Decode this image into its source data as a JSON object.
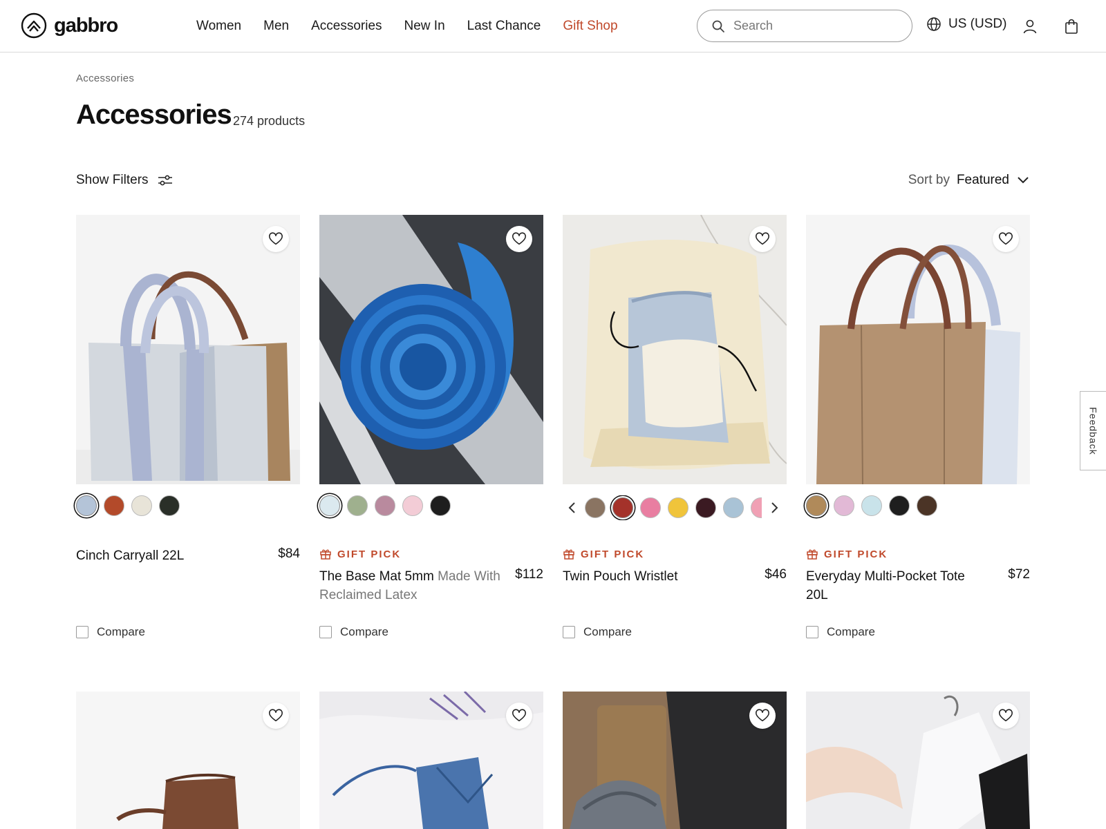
{
  "header": {
    "brand": "gabbro",
    "nav": [
      {
        "label": "Women"
      },
      {
        "label": "Men"
      },
      {
        "label": "Accessories"
      },
      {
        "label": "New In"
      },
      {
        "label": "Last Chance"
      },
      {
        "label": "Gift Shop",
        "color": "#c0492b"
      }
    ],
    "search_placeholder": "Search",
    "locale": "US (USD)"
  },
  "breadcrumb": "Accessories",
  "page": {
    "title": "Accessories",
    "count": "274 products"
  },
  "toolbar": {
    "filters_label": "Show Filters",
    "sort_label": "Sort by",
    "sort_value": "Featured"
  },
  "products": [
    {
      "name": "Cinch Carryall 22L",
      "subtitle": "",
      "price": "$84",
      "gift_pick": false,
      "compare_label": "Compare",
      "swatches": [
        "#b4c4d8",
        "#b34a2a",
        "#e8e4d8",
        "#2a2f28"
      ],
      "selected_swatch": 0
    },
    {
      "name": "The Base Mat 5mm",
      "subtitle": "Made With Reclaimed Latex",
      "price": "$112",
      "gift_pick": true,
      "gift_label": "GIFT PICK",
      "compare_label": "Compare",
      "swatches": [
        "#dbe9ef",
        "#9fb08e",
        "#b98a9e",
        "#f3ccd6",
        "#1e1e1e"
      ],
      "selected_swatch": 0
    },
    {
      "name": "Twin Pouch Wristlet",
      "subtitle": "",
      "price": "$46",
      "gift_pick": true,
      "gift_label": "GIFT PICK",
      "compare_label": "Compare",
      "swatches": [
        "#8a7462",
        "#a4322a",
        "#e97ea1",
        "#f0c43b",
        "#3b1a22",
        "#a9c3d6",
        "#f0a0b4",
        "#e8e4dc"
      ],
      "selected_swatch": 1
    },
    {
      "name": "Everyday Multi-Pocket Tote 20L",
      "subtitle": "",
      "price": "$72",
      "gift_pick": true,
      "gift_label": "GIFT PICK",
      "compare_label": "Compare",
      "swatches": [
        "#b08a5a",
        "#e2b9d6",
        "#c9e3ea",
        "#1e1e1e",
        "#4b3426"
      ],
      "selected_swatch": 0
    }
  ],
  "feedback_label": "Feedback"
}
